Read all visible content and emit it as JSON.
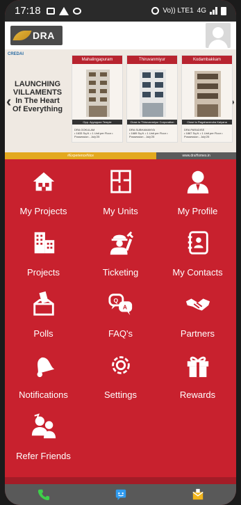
{
  "statusbar": {
    "time": "17:18",
    "network": "Vo)) LTE1",
    "network_type": "4G"
  },
  "header": {
    "logo_text": "DRA",
    "avatar_icon": "user-avatar-icon"
  },
  "banner": {
    "brand_small": "CREDAI",
    "headline_line1": "LAUNCHING",
    "headline_line2": "VILLAMENTS",
    "headline_line3": "In The Heart",
    "headline_line4": "Of Everything",
    "cards": [
      {
        "location": "Mahalingapuram",
        "caption": "Opp. Ayyappan Temple",
        "brand": "DRA GOKULAM",
        "details": "• 1633 Sq.ft. • 1 Unit per Floor • Possession - July'25"
      },
      {
        "location": "Thiruvanmiyur",
        "caption": "Close to Thiruvanmiyur Corporation Office",
        "brand": "DRA SUBHAMANYA",
        "details": "• 1689 Sq.ft. • 1 Unit per Floor • Possession - July'25"
      },
      {
        "location": "Kodambakkam",
        "caption": "Close to Ragahavendra Kalyana Mandapam",
        "brand": "DRA PARADISE",
        "details": "• 1867 Sq.ft. • 1 Unit per Floor • Possession - July'25"
      }
    ],
    "hashtag": "#ExperienceNice",
    "website": "www.draHomes.in"
  },
  "menu": [
    {
      "label": "My Projects",
      "icon": "house-icon"
    },
    {
      "label": "My Units",
      "icon": "floorplan-icon"
    },
    {
      "label": "My Profile",
      "icon": "profile-icon"
    },
    {
      "label": "Projects",
      "icon": "buildings-icon"
    },
    {
      "label": "Ticketing",
      "icon": "worker-icon"
    },
    {
      "label": "My Contacts",
      "icon": "contacts-book-icon"
    },
    {
      "label": "Polls",
      "icon": "ballot-box-icon"
    },
    {
      "label": "FAQ's",
      "icon": "qa-bubbles-icon"
    },
    {
      "label": "Partners",
      "icon": "handshake-icon"
    },
    {
      "label": "Notifications",
      "icon": "bell-icon"
    },
    {
      "label": "Settings",
      "icon": "gear-icon"
    },
    {
      "label": "Rewards",
      "icon": "gift-icon"
    },
    {
      "label": "Refer Friends",
      "icon": "refer-friends-icon"
    }
  ],
  "bottom_nav": [
    {
      "icon": "phone-icon",
      "color": "#3ecf4a"
    },
    {
      "icon": "chat-icon",
      "color": "#2f9bf0"
    },
    {
      "icon": "mail-icon",
      "color": "#f2b51c"
    }
  ],
  "colors": {
    "primary": "#c8212e",
    "statusbar": "#2a2a2a",
    "bottomnav": "#595959"
  }
}
